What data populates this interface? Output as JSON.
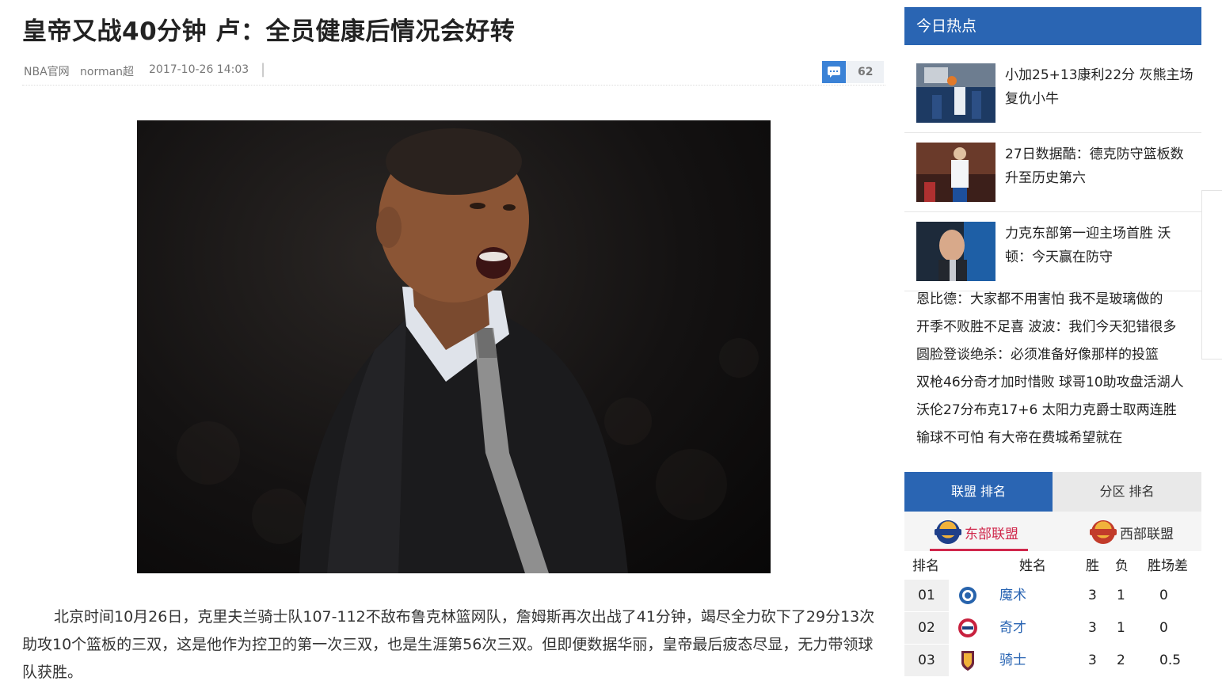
{
  "article": {
    "title": "皇帝又战40分钟 卢：全员健康后情况会好转",
    "source": "NBA官网",
    "author": "norman超",
    "time": "2017-10-26 14:03",
    "separator": "|",
    "comment_count": "62",
    "paragraph": "北京时间10月26日，克里夫兰骑士队107-112不敌布鲁克林篮网队，詹姆斯再次出战了41分钟，竭尽全力砍下了29分13次助攻10个篮板的三双，这是他作为控卫的第一次三双，也是生涯第56次三双。但即便数据华丽，皇帝最后疲态尽显，无力带领球队获胜。"
  },
  "sidebar": {
    "hot_title": "今日热点",
    "hot_items": [
      {
        "title": "小加25+13康利22分 灰熊主场复仇小牛"
      },
      {
        "title": "27日数据酷：德克防守篮板数升至历史第六"
      },
      {
        "title": "力克东部第一迎主场首胜 沃顿：今天赢在防守"
      }
    ],
    "hot_list": [
      "恩比德：大家都不用害怕 我不是玻璃做的",
      "开季不败胜不足喜 波波：我们今天犯错很多",
      "圆脸登谈绝杀：必须准备好像那样的投篮",
      "双枪46分奇才加时惜败 球哥10助攻盘活湖人",
      "沃伦27分布克17+6 太阳力克爵士取两连胜",
      "输球不可怕 有大帝在费城希望就在"
    ],
    "rank_tabs": [
      "联盟 排名",
      "分区 排名"
    ],
    "conferences": [
      "东部联盟",
      "西部联盟"
    ],
    "standings": {
      "headers": [
        "排名",
        "姓名",
        "胜",
        "负",
        "胜场差"
      ],
      "rows": [
        {
          "rank": "01",
          "team": "魔术",
          "w": "3",
          "l": "1",
          "gb": "0"
        },
        {
          "rank": "02",
          "team": "奇才",
          "w": "3",
          "l": "1",
          "gb": "0"
        },
        {
          "rank": "03",
          "team": "骑士",
          "w": "3",
          "l": "2",
          "gb": "0.5"
        }
      ]
    }
  },
  "colors": {
    "accent_blue": "#2a65b3",
    "east_red": "#d0274b",
    "link_blue": "#2a65b3"
  }
}
